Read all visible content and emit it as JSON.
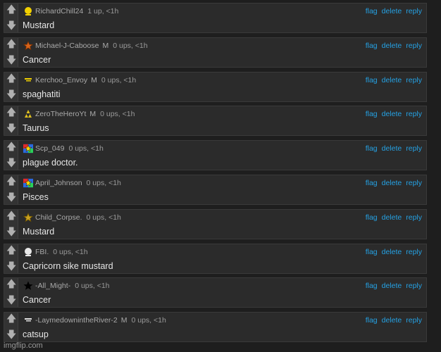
{
  "actions": {
    "flag": "flag",
    "delete": "delete",
    "reply": "reply"
  },
  "vote_icons": {
    "up": "up-arrow-icon",
    "down": "down-arrow-icon"
  },
  "comments": [
    {
      "username": "RichardChill24",
      "mod": "",
      "ups": "1 up, <1h",
      "text": "Mustard",
      "avatar": "yellow-user-icon"
    },
    {
      "username": "Michael-J-Caboose",
      "mod": "M",
      "ups": "0 ups, <1h",
      "text": "Cancer",
      "avatar": "orange-star-icon"
    },
    {
      "username": "Kerchoo_Envoy",
      "mod": "M",
      "ups": "0 ups, <1h",
      "text": "spaghatiti",
      "avatar": "yellow-dash-icon"
    },
    {
      "username": "ZeroTheHeroYt",
      "mod": "M",
      "ups": "0 ups, <1h",
      "text": "Taurus",
      "avatar": "triforce-icon"
    },
    {
      "username": "Scp_049",
      "mod": "",
      "ups": "0 ups, <1h",
      "text": "plague doctor.",
      "avatar": "colorful-star-flag-icon"
    },
    {
      "username": "April_Johnson",
      "mod": "",
      "ups": "0 ups, <1h",
      "text": "Pisces",
      "avatar": "colorful-star-flag-icon"
    },
    {
      "username": "Child_Corpse.",
      "mod": "",
      "ups": "0 ups, <1h",
      "text": "Mustard",
      "avatar": "gold-star-icon"
    },
    {
      "username": "FBI.",
      "mod": "",
      "ups": "0 ups, <1h",
      "text": "Capricorn sike mustard",
      "avatar": "white-user-icon"
    },
    {
      "username": "-All_Might-",
      "mod": "",
      "ups": "0 ups, <1h",
      "text": "Cancer",
      "avatar": "black-star-icon"
    },
    {
      "username": "-LaymedownintheRiver-2",
      "mod": "M",
      "ups": "0 ups, <1h",
      "text": "catsup",
      "avatar": "white-dash-icon"
    }
  ],
  "watermark": "imgflip.com"
}
